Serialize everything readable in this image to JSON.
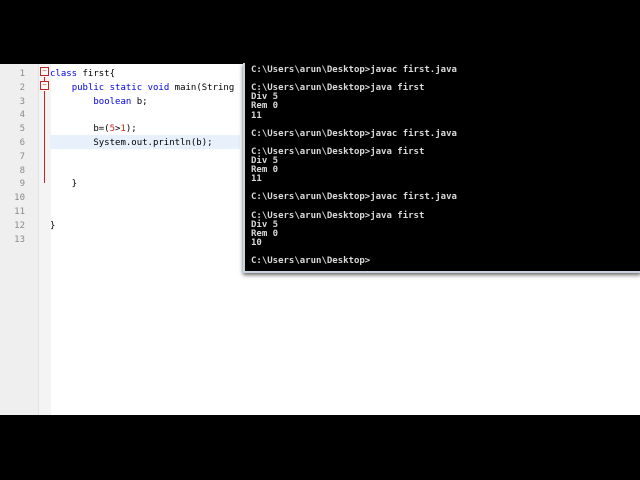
{
  "editor": {
    "lines": [
      {
        "n": "1",
        "text": "class first{"
      },
      {
        "n": "2",
        "text": "    public static void main(String"
      },
      {
        "n": "3",
        "text": "        boolean b;"
      },
      {
        "n": "4",
        "text": ""
      },
      {
        "n": "5",
        "text": "        b=(5>1);"
      },
      {
        "n": "6",
        "text": "        System.out.println(b);"
      },
      {
        "n": "7",
        "text": ""
      },
      {
        "n": "8",
        "text": ""
      },
      {
        "n": "9",
        "text": "    }"
      },
      {
        "n": "10",
        "text": ""
      },
      {
        "n": "11",
        "text": ""
      },
      {
        "n": "12",
        "text": "}"
      },
      {
        "n": "13",
        "text": ""
      }
    ]
  },
  "console": {
    "lines": [
      "C:\\Users\\arun\\Desktop>javac first.java",
      "",
      "C:\\Users\\arun\\Desktop>java first",
      "Div 5",
      "Rem 0",
      "11",
      "",
      "C:\\Users\\arun\\Desktop>javac first.java",
      "",
      "C:\\Users\\arun\\Desktop>java first",
      "Div 5",
      "Rem 0",
      "11",
      "",
      "C:\\Users\\arun\\Desktop>javac first.java",
      "",
      "C:\\Users\\arun\\Desktop>java first",
      "Div 5",
      "Rem 0",
      "10",
      "",
      "C:\\Users\\arun\\Desktop>"
    ]
  }
}
